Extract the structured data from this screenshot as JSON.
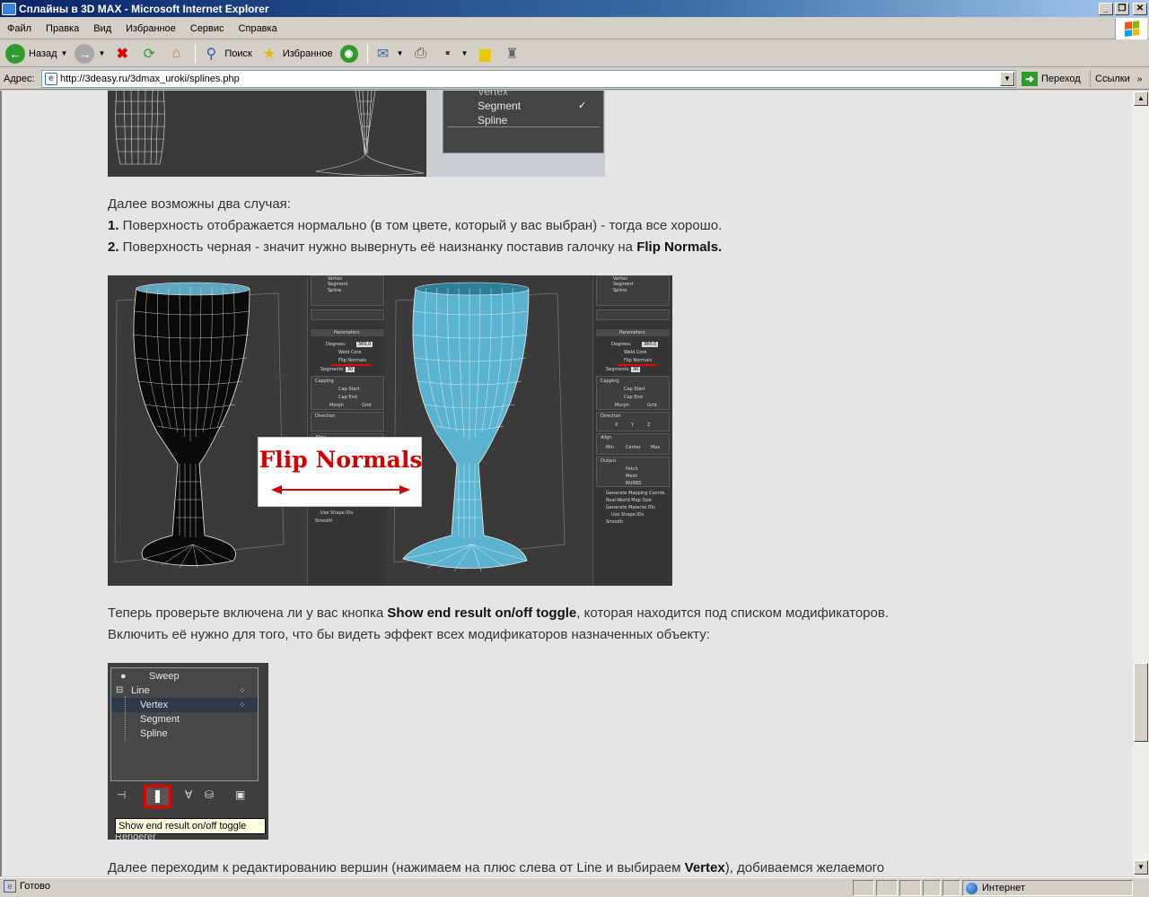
{
  "window": {
    "title": "Сплайны в 3D MAX - Microsoft Internet Explorer",
    "minimize": "_",
    "restore": "❐",
    "close": "✕"
  },
  "menu": {
    "items": [
      {
        "label": "Файл"
      },
      {
        "label": "Правка"
      },
      {
        "label": "Вид"
      },
      {
        "label": "Избранное"
      },
      {
        "label": "Сервис"
      },
      {
        "label": "Справка"
      }
    ]
  },
  "toolbar": {
    "back_label": "Назад",
    "search_label": "Поиск",
    "favorites_label": "Избранное"
  },
  "address": {
    "label": "Адрес:",
    "url": "http://3deasy.ru/3dmax_uroki/splines.php",
    "go_label": "Переход",
    "links_label": "Ссылки"
  },
  "article": {
    "img1_stack": [
      "Vertex",
      "Segment",
      "Spline"
    ],
    "para1_intro": "Далее возможны два случая:",
    "case1_num": "1.",
    "case1_text": " Поверхность отображается нормально (в том цвете, который у вас выбран) - тогда все хорошо.",
    "case2_num": "2.",
    "case2_text": " Поверхность черная - значит нужно вывернуть её наизнанку поставив галочку на ",
    "case2_bold": "Flip Normals.",
    "img2_label": "Flip Normals",
    "img2_panel": {
      "stack": [
        "Vertex",
        "Segment",
        "Spline"
      ],
      "parameters": "Parameters",
      "degrees_label": "Degrees:",
      "degrees_value": "360,0",
      "weld_core": "Weld Core",
      "flip_normals": "Flip Normals",
      "segments_label": "Segments:",
      "segments_value": "30",
      "capping": "Capping",
      "cap_start": "Cap Start",
      "cap_end": "Cap End",
      "morph": "Morph",
      "grid": "Grid",
      "direction": "Direction",
      "dir_x": "X",
      "dir_y": "Y",
      "dir_z": "Z",
      "align": "Align",
      "align_min": "Min",
      "align_center": "Center",
      "align_max": "Max",
      "output": "Output",
      "patch": "Patch",
      "mesh": "Mesh",
      "nurbs": "NURBS",
      "gen_mapping": "Generate Mapping Coords.",
      "real_world": "Real-World Map Size",
      "gen_material": "Generate Material IDs",
      "use_shape": "Use Shape IDs",
      "smooth": "Smooth"
    },
    "para2_pre": "Теперь проверьте включена ли у вас кнопка ",
    "para2_bold": "Show end result on/off toggle",
    "para2_post": ", которая находится под списком модификаторов.",
    "para3": "Включить её нужно для того, что бы видеть эффект всех модификаторов назначенных объекту:",
    "img3": {
      "sweep": "Sweep",
      "line": "Line",
      "vertex": "Vertex",
      "segment": "Segment",
      "spline": "Spline",
      "tooltip": "Show end result on/off toggle",
      "under_tooltip": "Renderer"
    },
    "para4_pre": "Далее переходим к редактированию вершин (нажимаем на плюс слева от Line и выбираем ",
    "para4_bold": "Vertex",
    "para4_post": "), добиваемся желаемого"
  },
  "status": {
    "text": "Готово",
    "zone": "Интернет"
  },
  "colors": {
    "title_gradient_start": "#0a246a",
    "content_bg": "#e5e5e5",
    "flip_normals_red": "#d40000",
    "highlight_red": "#e00000"
  }
}
